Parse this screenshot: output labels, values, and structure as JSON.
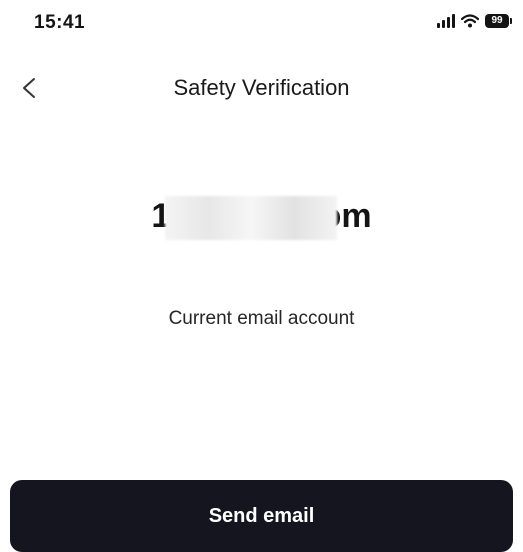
{
  "status_bar": {
    "time": "15:41",
    "battery_level": "99",
    "icons": [
      "signal-icon",
      "wifi-icon",
      "battery-icon"
    ]
  },
  "nav": {
    "back_icon": "chevron-left-icon",
    "title": "Safety Verification"
  },
  "account": {
    "email": "1@gmail.com",
    "caption": "Current email account"
  },
  "actions": {
    "send_label": "Send email",
    "button_color": "#15151f"
  }
}
